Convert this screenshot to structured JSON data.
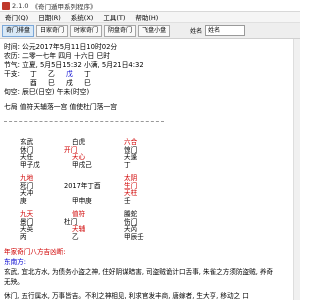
{
  "titlebar": {
    "version": "2.1.0",
    "title": "《奇门遁甲系列程序》"
  },
  "menu": [
    "奇门(Q)",
    "日期(R)",
    "系统(X)",
    "工具(T)",
    "帮助(H)"
  ],
  "toolbar": {
    "buttons": [
      "奇门排盘",
      "日家奇门",
      "时家奇门",
      "阴盘奇门",
      "飞盘小盘"
    ],
    "name_label": "姓名",
    "name_value": "姓名"
  },
  "info": {
    "line1": "时间: 公元2017年5月11日10时02分",
    "line2": "农历: 二零一七年 四月 十六日 巳时",
    "line3": "节气: 立夏, 5月5日15:32  小满, 5月21日4:32",
    "line4_label": "干支:",
    "ganzhi": [
      "丁",
      "乙",
      "戊",
      "丁"
    ],
    "zhi": [
      "酉",
      "巳",
      "戌",
      "巳"
    ],
    "xunkong": "旬空: 辰巳(日空)  午未(时空)",
    "ju": "七局  值符天辅落一宫  值使杜门落一宫"
  },
  "palaces": [
    {
      "col": 0,
      "row": 0,
      "lines": [
        "玄武",
        "休门",
        "天任",
        "甲子戊"
      ],
      "colors": [
        "#000",
        "#000",
        "#000",
        "#000"
      ]
    },
    {
      "col": 1,
      "row": 0,
      "lines": [
        "白虎",
        "开门",
        "天心",
        "甲戌己"
      ],
      "colors": [
        "#000",
        "#d00000",
        "#d00000",
        "#000"
      ]
    },
    {
      "col": 2,
      "row": 0,
      "lines": [
        "六合",
        "惊门",
        "天蓬",
        "丁"
      ],
      "colors": [
        "#d00000",
        "#000",
        "#000",
        "#000"
      ]
    },
    {
      "col": 0,
      "row": 1,
      "lines": [
        "九地",
        "死门",
        "天冲",
        "庚"
      ],
      "colors": [
        "#d00000",
        "#000",
        "#000",
        "#000"
      ]
    },
    {
      "col": 1,
      "row": 1,
      "lines": [
        "",
        "2017年丁酉",
        "",
        "甲申庚"
      ],
      "colors": [
        "#000",
        "#000",
        "#000",
        "#000"
      ]
    },
    {
      "col": 2,
      "row": 1,
      "lines": [
        "太阴",
        "生门",
        "天柱",
        "壬"
      ],
      "colors": [
        "#d00000",
        "#d00000",
        "#d00000",
        "#000"
      ]
    },
    {
      "col": 0,
      "row": 2,
      "lines": [
        "九天",
        "景门",
        "天英",
        "丙"
      ],
      "colors": [
        "#d00000",
        "#000",
        "#000",
        "#000"
      ]
    },
    {
      "col": 1,
      "row": 2,
      "lines": [
        "值符",
        "杜门",
        "天辅",
        "乙"
      ],
      "colors": [
        "#d00000",
        "#000",
        "#d00000",
        "#000"
      ]
    },
    {
      "col": 2,
      "row": 2,
      "lines": [
        "螣蛇",
        "伤门",
        "天芮",
        "甲辰壬"
      ],
      "colors": [
        "#000",
        "#000",
        "#000",
        "#000"
      ]
    }
  ],
  "bottom": {
    "title": "年家奇门八方吉凶断:",
    "subtitle": "东南方:",
    "para1": "玄武, 宜北方水, 为债务小盗之神, 住好阴谋暗害, 司盗贼诡计口舌事, 朱雀之方须防盗贼, 养奇",
    "para2": "无殃。",
    "para3": "休门, 五行属水, 万事皆吉。不利之神相见, 利求官发丰商, 唐嫁者, 生大亨, 移动之 口"
  }
}
